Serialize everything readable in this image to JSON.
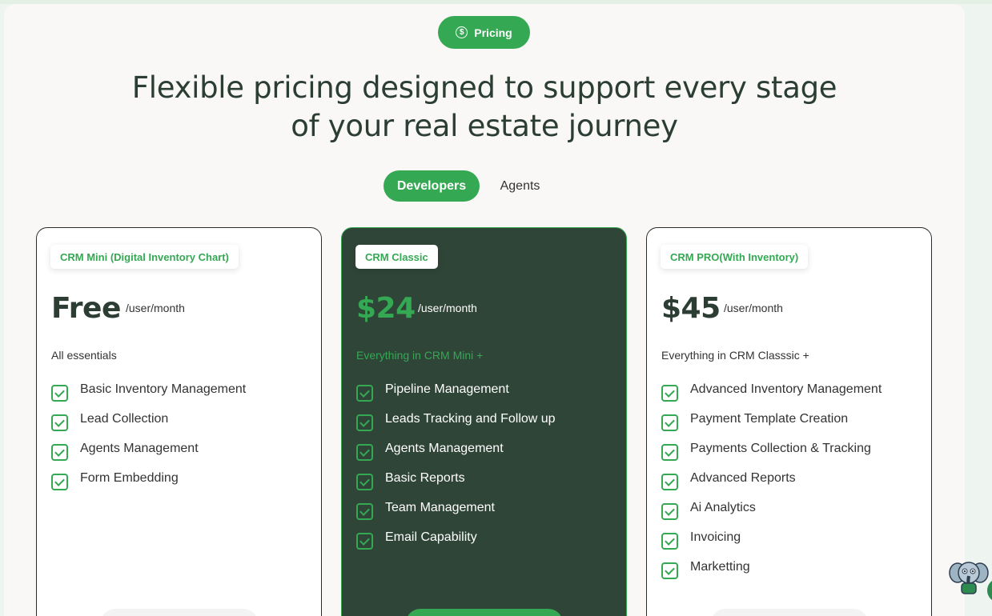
{
  "badge": {
    "label": "Pricing",
    "icon": "dollar-coin-icon"
  },
  "headline": "Flexible pricing designed to support every stage of your real estate journey",
  "toggle": {
    "options": [
      "Developers",
      "Agents"
    ],
    "selected": "Developers"
  },
  "plans": [
    {
      "tag": "CRM Mini (Digital Inventory Chart)",
      "price": "Free",
      "per": "/user/month",
      "subtitle": "All essentials",
      "features": [
        "Basic Inventory Management",
        "Lead Collection",
        "Agents Management",
        "Form Embedding"
      ]
    },
    {
      "tag": "CRM Classic",
      "price": "$24",
      "per": "/user/month",
      "subtitle": "Everything in CRM Mini +",
      "features": [
        "Pipeline Management",
        "Leads Tracking and Follow up",
        "Agents Management",
        "Basic Reports",
        "Team Management",
        "Email Capability"
      ]
    },
    {
      "tag": "CRM PRO(With Inventory)",
      "price": "$45",
      "per": "/user/month",
      "subtitle": "Everything in CRM Classsic +",
      "features": [
        "Advanced Inventory Management",
        "Payment Template Creation",
        "Payments Collection & Tracking",
        "Advanced Reports",
        "Ai Analytics",
        "Invoicing",
        "Marketting"
      ]
    }
  ],
  "colors": {
    "accent": "#34a853",
    "dark": "#2f4538",
    "heading": "#2c3e34"
  }
}
